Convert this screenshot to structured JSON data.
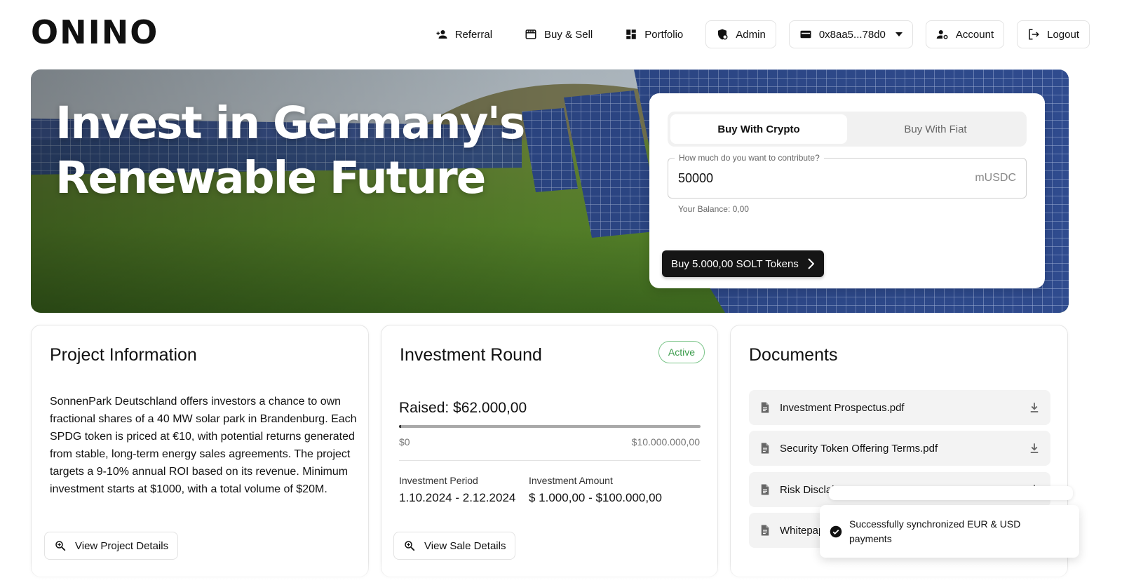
{
  "brand": {
    "logo_text": "ONINO"
  },
  "nav": {
    "referral": "Referral",
    "buy_sell": "Buy & Sell",
    "portfolio": "Portfolio",
    "admin": "Admin",
    "wallet": "0x8aa5...78d0",
    "account": "Account",
    "logout": "Logout"
  },
  "hero": {
    "title_line1": "Invest in Germany's",
    "title_line2": "Renewable Future"
  },
  "buy_card": {
    "tab_crypto": "Buy With Crypto",
    "tab_fiat": "Buy With Fiat",
    "amount_label": "How much do you want to contribute?",
    "amount_value": "50000",
    "amount_unit": "mUSDC",
    "balance": "Your Balance: 0,00",
    "buy_button": "Buy 5.000,00 SOLT Tokens"
  },
  "project": {
    "title": "Project Information",
    "description": "SonnenPark Deutschland offers investors a chance to own fractional shares of a 40 MW solar park in Brandenburg. Each SPDG token is priced at €10, with potential returns generated from stable, long-term energy sales agreements. The project targets a 9-10% annual ROI based on its revenue. Minimum investment starts at $1000, with a total volume of $20M.",
    "details_button": "View Project Details"
  },
  "round": {
    "title": "Investment Round",
    "status": "Active",
    "raised": "Raised: $62.000,00",
    "progress_fraction": 0.0062,
    "min": "$0",
    "max": "$10.000.000,00",
    "period_label": "Investment Period",
    "period_value": "1.10.2024 - 2.12.2024",
    "amount_label": "Investment Amount",
    "amount_value": "$ 1.000,00 - $100.000,00",
    "details_button": "View Sale Details"
  },
  "documents": {
    "title": "Documents",
    "items": [
      {
        "name": "Investment Prospectus.pdf"
      },
      {
        "name": "Security Token Offering Terms.pdf"
      },
      {
        "name": "Risk Disclair"
      },
      {
        "name": "Whitepap"
      }
    ]
  },
  "toast": {
    "message": "Successfully synchronized EUR & USD payments"
  }
}
